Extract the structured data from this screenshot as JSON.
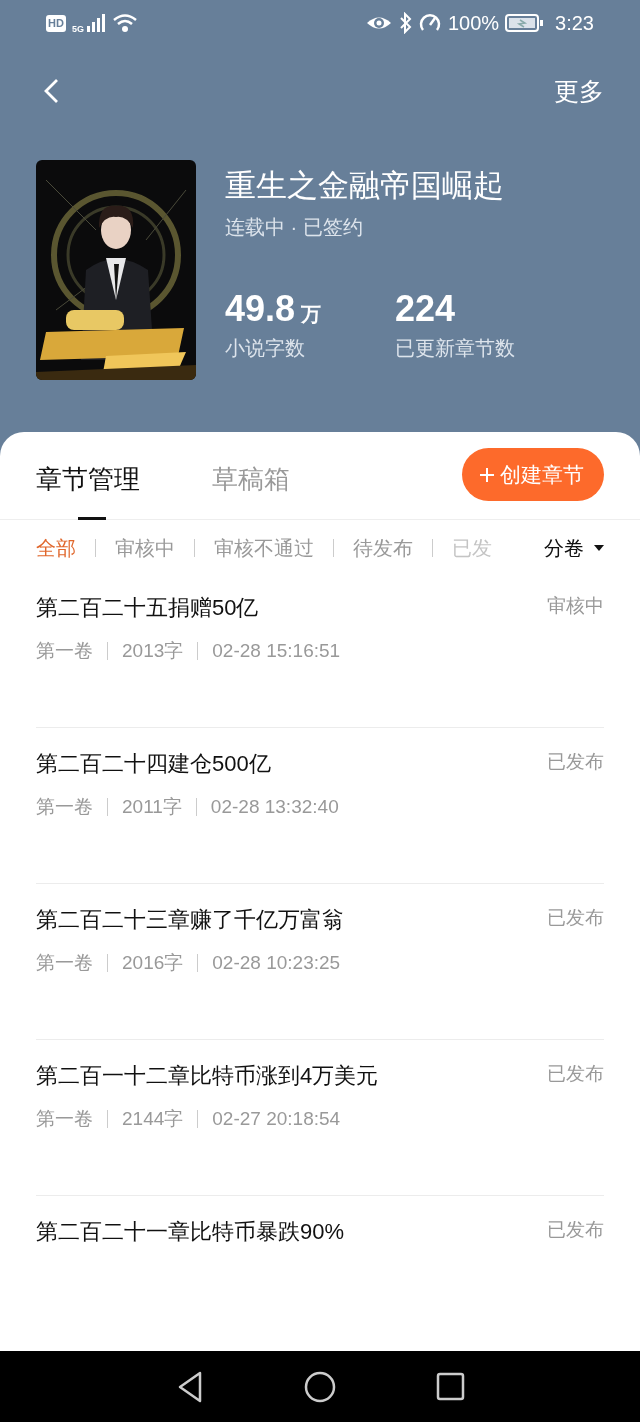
{
  "status_bar": {
    "hd": "HD",
    "network": "5G",
    "battery": "100%",
    "time": "3:23"
  },
  "top_bar": {
    "more": "更多"
  },
  "book": {
    "title": "重生之金融帝国崛起",
    "status": "连载中 · 已签约",
    "stats": [
      {
        "value": "49.8",
        "unit": "万",
        "label": "小说字数"
      },
      {
        "value": "224",
        "label": "已更新章节数"
      }
    ]
  },
  "tabs": [
    {
      "label": "章节管理",
      "selected": true
    },
    {
      "label": "草稿箱",
      "selected": false
    }
  ],
  "create_button": {
    "label": "创建章节"
  },
  "filters": [
    {
      "label": "全部",
      "selected": true
    },
    {
      "label": "审核中",
      "selected": false
    },
    {
      "label": "审核不通过",
      "selected": false
    },
    {
      "label": "待发布",
      "selected": false
    },
    {
      "label": "已发",
      "selected": false
    }
  ],
  "volume_dropdown": {
    "label": "分卷"
  },
  "chapters": [
    {
      "title": "第二百二十五捐赠50亿",
      "status": "审核中",
      "volume": "第一卷",
      "words": "2013字",
      "time": "02-28 15:16:51"
    },
    {
      "title": "第二百二十四建仓500亿",
      "status": "已发布",
      "volume": "第一卷",
      "words": "2011字",
      "time": "02-28 13:32:40"
    },
    {
      "title": "第二百二十三章赚了千亿万富翁",
      "status": "已发布",
      "volume": "第一卷",
      "words": "2016字",
      "time": "02-28 10:23:25"
    },
    {
      "title": "第二百一十二章比特币涨到4万美元",
      "status": "已发布",
      "volume": "第一卷",
      "words": "2144字",
      "time": "02-27 20:18:54"
    },
    {
      "title": "第二百二十一章比特币暴跌90%",
      "status": "已发布"
    }
  ]
}
